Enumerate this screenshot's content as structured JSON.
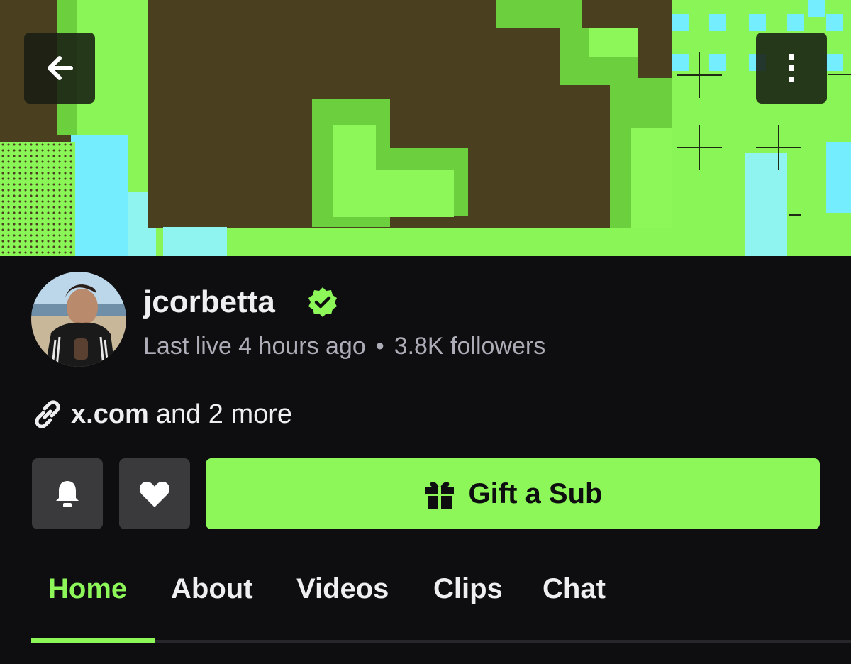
{
  "channel": {
    "name": "jcorbetta",
    "verified": true,
    "last_live": "Last live 4 hours ago",
    "separator": "•",
    "followers": "3.8K followers"
  },
  "links": {
    "primary": "x.com",
    "more": "and 2 more"
  },
  "actions": {
    "gift_label": "Gift a Sub"
  },
  "tabs": [
    {
      "label": "Home",
      "active": true
    },
    {
      "label": "About",
      "active": false
    },
    {
      "label": "Videos",
      "active": false
    },
    {
      "label": "Clips",
      "active": false
    },
    {
      "label": "Chat",
      "active": false
    }
  ],
  "icons": {
    "back": "arrow-left-icon",
    "more": "more-vertical-icon",
    "verified": "verified-badge-icon",
    "link": "link-icon",
    "notify": "bell-icon",
    "follow": "heart-icon",
    "gift": "gift-icon"
  },
  "colors": {
    "accent": "#8df75a",
    "background": "#0e0e10",
    "secondary_text": "#adadb8",
    "button_gray": "#3a3a3d"
  }
}
